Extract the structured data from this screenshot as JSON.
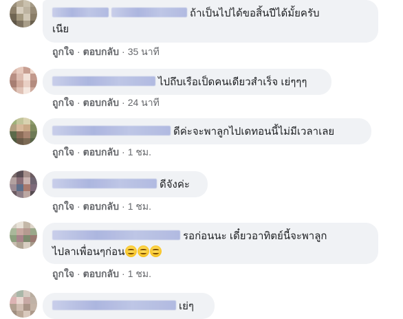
{
  "comments": [
    {
      "text": "ถ้าเป็นไปได้ขอสิ้นปีได้มั้ยครับ",
      "text_line2": "เนีย",
      "like": "ถูกใจ",
      "reply": "ตอบกลับ",
      "time": "35 นาที"
    },
    {
      "text": "ไปถึบเรือเป็ดคนเดียวสำเร็จ เย่ๆๆๆ",
      "like": "ถูกใจ",
      "reply": "ตอบกลับ",
      "time": "24 นาที"
    },
    {
      "text": "ดีค่ะจะพาลูกไปเดทอนนี้ไม่มีเวลาเลย",
      "like": "ถูกใจ",
      "reply": "ตอบกลับ",
      "time": "1 ชม."
    },
    {
      "text": "ดีจังค่ะ",
      "like": "ถูกใจ",
      "reply": "ตอบกลับ",
      "time": "1 ชม."
    },
    {
      "text": "รอก่อนนะ เดี๋ยวอาทิตย์นี้จะพาลูก",
      "text_line2": "ไปลาเพื่อนๆก่อน",
      "emoji_name": "smiling-face-emoji",
      "like": "ถูกใจ",
      "reply": "ตอบกลับ",
      "time": "1 ชม."
    },
    {
      "text": "เย่ๆ"
    }
  ],
  "separator": "·",
  "colors": {
    "bubble": "#f0f2f5",
    "action_text": "#65676b",
    "body_text": "#1c1e21"
  }
}
